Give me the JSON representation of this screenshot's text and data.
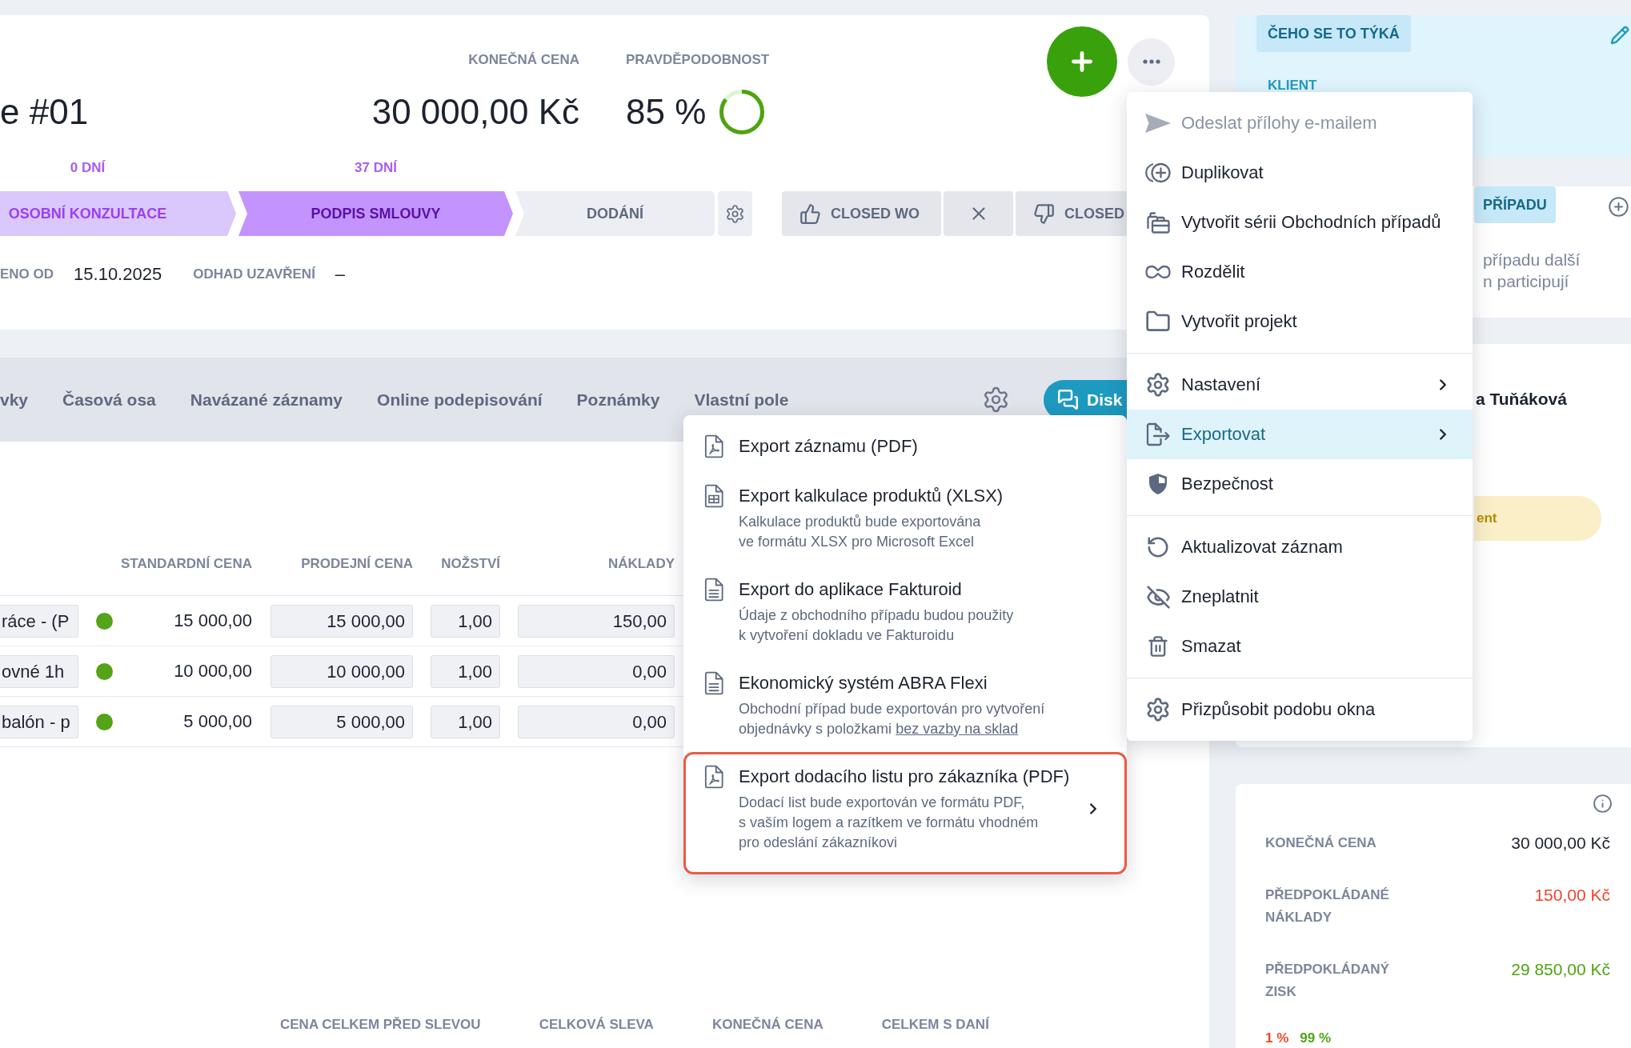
{
  "header": {
    "title": "e #01",
    "stats": [
      {
        "label": "KONEČNÁ CENA",
        "value": "30 000,00 Kč"
      },
      {
        "label": "PRAVDĚPODOBNOST",
        "value": "85 %",
        "level": 0.85
      }
    ],
    "stages": [
      {
        "label": "OSOBNÍ KONZULTACE",
        "days": "0 DNÍ",
        "completed": true,
        "selected": false
      },
      {
        "label": "PODPIS SMLOUVY",
        "days": "37 DNÍ",
        "completed": false,
        "selected": true
      },
      {
        "label": "DODÁNÍ",
        "completed": false,
        "selected": false
      }
    ],
    "outcomes": [
      {
        "kind": "won",
        "label": "CLOSED WO"
      },
      {
        "kind": "dismiss"
      },
      {
        "kind": "lost",
        "label": "CLOSED"
      }
    ],
    "dates": [
      {
        "label": "ENO OD",
        "value": "15.10.2025"
      },
      {
        "label": "ODHAD UZAVŘENÍ",
        "value": "–"
      }
    ]
  },
  "tabs": {
    "items": [
      {
        "label": "vky",
        "selected": false
      },
      {
        "label": "Časová osa",
        "selected": false
      },
      {
        "label": "Navázané záznamy",
        "selected": false
      },
      {
        "label": "Online podepisování",
        "selected": false
      },
      {
        "label": "Poznámky",
        "selected": false
      },
      {
        "label": "Vlastní pole",
        "selected": false
      }
    ],
    "discussion_button": "Disk"
  },
  "products": {
    "columns": [
      "STANDARDNÍ CENA",
      "PRODEJNÍ CENA",
      "NOŽSTVÍ",
      "NÁKLADY"
    ],
    "rows": [
      {
        "name": "ráce - (P",
        "color": "#54a318",
        "standard_price": "15 000,00",
        "selling_price": "15 000,00",
        "quantity": "1,00",
        "costs": "150,00"
      },
      {
        "name": "ovné 1h",
        "color": "#54a318",
        "standard_price": "10 000,00",
        "selling_price": "10 000,00",
        "quantity": "1,00",
        "costs": "0,00"
      },
      {
        "name": "balón - p",
        "color": "#54a318",
        "standard_price": "5 000,00",
        "selling_price": "5 000,00",
        "quantity": "1,00",
        "costs": "0,00"
      }
    ]
  },
  "totals": [
    "CENA CELKEM PŘED SLEVOU",
    "CELKOVÁ SLEVA",
    "KONEČNÁ CENA",
    "CELKEM S DANÍ"
  ],
  "sidebar": {
    "subject": {
      "badge": "ČEHO SE TO TÝKÁ",
      "label": "KLIENT"
    },
    "participants": {
      "badge": "PŘÍPADU",
      "text": "případu další\nn participují"
    },
    "owner": {
      "name": "a Tuňáková",
      "tag": "ent"
    },
    "summary": {
      "rows": [
        {
          "label": "KONEČNÁ CENA",
          "value": "30 000,00 Kč",
          "color": "#1d2230"
        },
        {
          "label": "PŘEDPOKLÁDANÉ\nNÁKLADY",
          "value": "150,00 Kč",
          "color": "#f0452b"
        },
        {
          "label": "PŘEDPOKLÁDANÝ\nZISK",
          "value": "29 850,00 Kč",
          "color": "#4ea40f"
        }
      ],
      "split": [
        {
          "text": "1 %",
          "color": "#f0452b"
        },
        {
          "text": "99 %",
          "color": "#4ea40f"
        }
      ]
    }
  },
  "actions_menu": {
    "groups": [
      [
        {
          "label": "Odeslat přílohy e-mailem",
          "disabled": true,
          "selected": false,
          "submenu": false
        },
        {
          "label": "Duplikovat",
          "disabled": false,
          "selected": false,
          "submenu": false
        },
        {
          "label": "Vytvořit sérii Obchodních případů",
          "disabled": false,
          "selected": false,
          "submenu": false
        },
        {
          "label": "Rozdělit",
          "disabled": false,
          "selected": false,
          "submenu": false
        },
        {
          "label": "Vytvořit projekt",
          "disabled": false,
          "selected": false,
          "submenu": false
        }
      ],
      [
        {
          "label": "Nastavení",
          "disabled": false,
          "selected": false,
          "submenu": true
        },
        {
          "label": "Exportovat",
          "disabled": false,
          "selected": true,
          "submenu": true
        },
        {
          "label": "Bezpečnost",
          "disabled": false,
          "selected": false,
          "submenu": false
        }
      ],
      [
        {
          "label": "Aktualizovat záznam",
          "disabled": false,
          "selected": false,
          "submenu": false
        },
        {
          "label": "Zneplatnit",
          "disabled": false,
          "selected": false,
          "submenu": false
        },
        {
          "label": "Smazat",
          "disabled": false,
          "selected": false,
          "submenu": false
        }
      ],
      [
        {
          "label": "Přizpůsobit podobu okna",
          "disabled": false,
          "selected": false,
          "submenu": false
        }
      ]
    ]
  },
  "export_submenu": {
    "items": [
      {
        "title": "Export záznamu (PDF)",
        "selected": false,
        "submenu": false
      },
      {
        "title": "Export kalkulace produktů (XLSX)",
        "description": "Kalkulace produktů bude exportována\nve formátu XLSX pro Microsoft Excel",
        "selected": false,
        "submenu": false
      },
      {
        "title": "Export do aplikace Fakturoid",
        "description": "Údaje z obchodního případu budou použity\nk vytvoření dokladu ve Fakturoidu",
        "selected": false,
        "submenu": false
      },
      {
        "title": "Ekonomický systém ABRA Flexi",
        "description": "Obchodní případ bude exportován pro vytvoření\nobjednávky s položkami",
        "link": "bez vazby na sklad",
        "selected": false,
        "submenu": false
      },
      {
        "title": "Export dodacího listu pro zákazníka (PDF)",
        "description": "Dodací list bude exportován ve formátu PDF,\ns vaším logem a razítkem ve formátu vhodném\npro odeslání zákazníkovi",
        "selected": true,
        "submenu": true
      }
    ]
  }
}
